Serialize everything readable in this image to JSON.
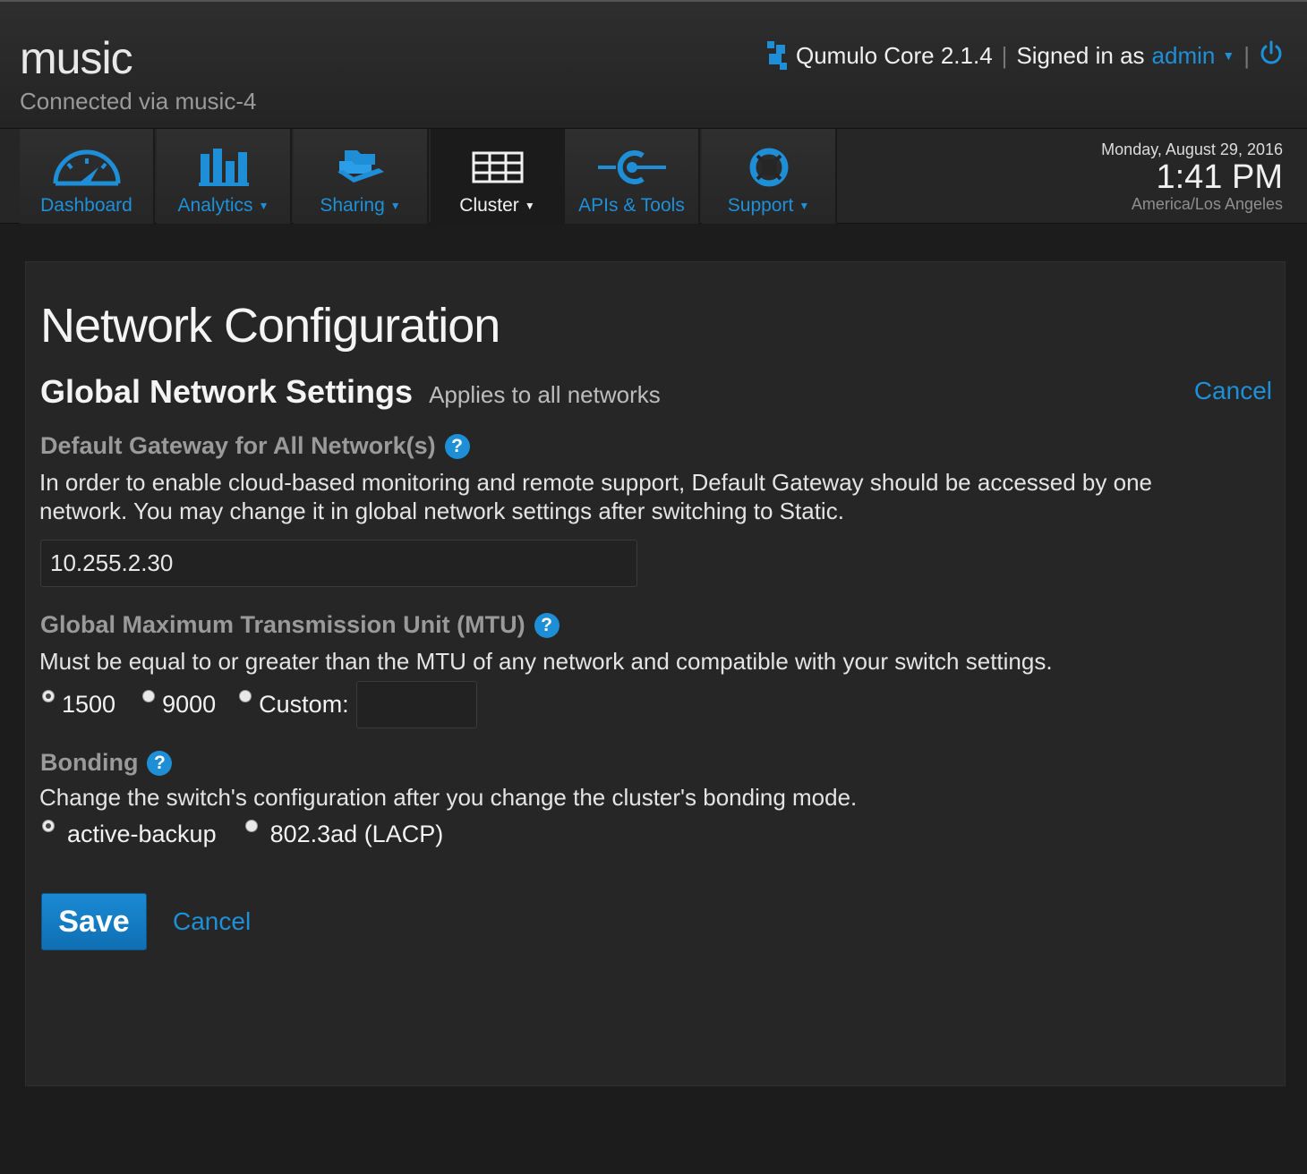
{
  "header": {
    "cluster_name": "music",
    "connected": "Connected via music-4",
    "product": "Qumulo Core 2.1.4",
    "signed_in_prefix": "Signed in as",
    "user": "admin"
  },
  "nav": {
    "items": [
      {
        "label": "Dashboard",
        "icon": "gauge-icon"
      },
      {
        "label": "Analytics",
        "icon": "bar-chart-icon"
      },
      {
        "label": "Sharing",
        "icon": "folders-icon"
      },
      {
        "label": "Cluster",
        "icon": "server-icon"
      },
      {
        "label": "APIs & Tools",
        "icon": "api-connector-icon"
      },
      {
        "label": "Support",
        "icon": "lifebuoy-icon"
      }
    ],
    "active": "Cluster"
  },
  "clock": {
    "date": "Monday, August 29, 2016",
    "time": "1:41 PM",
    "timezone": "America/Los Angeles"
  },
  "page": {
    "title": "Network Configuration",
    "section_title": "Global Network Settings",
    "section_subtitle": "Applies to all networks",
    "cancel_top": "Cancel",
    "gateway": {
      "label": "Default Gateway for All Network(s)",
      "description": "In order to enable cloud-based monitoring and remote support, Default Gateway should be accessed by one network. You may change it in global network settings after switching to Static.",
      "value": "10.255.2.30"
    },
    "mtu": {
      "label": "Global Maximum Transmission Unit (MTU)",
      "description": "Must be equal to or greater than the MTU of any network and compatible with your switch settings.",
      "options": [
        "1500",
        "9000",
        "Custom:"
      ],
      "selected": "1500",
      "custom_value": ""
    },
    "bonding": {
      "label": "Bonding",
      "description": "Change the switch's configuration after you change the cluster's bonding mode.",
      "options": [
        "active-backup",
        "802.3ad (LACP)"
      ],
      "selected": "active-backup"
    },
    "save_label": "Save",
    "cancel_bottom": "Cancel"
  },
  "colors": {
    "accent": "#1e90d8",
    "background": "#1c1c1c",
    "panel": "#262626"
  }
}
